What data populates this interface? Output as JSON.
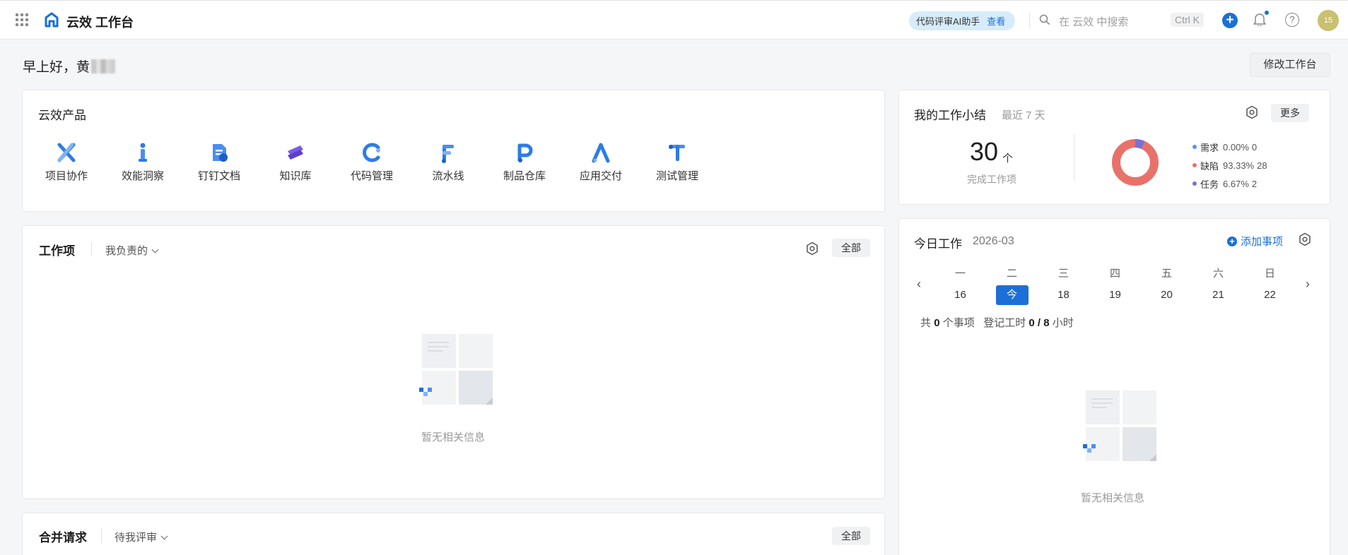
{
  "topbar": {
    "brand": "云效 工作台",
    "ai_pill": "代码评审AI助手",
    "ai_link": "查看",
    "search_placeholder": "在 云效 中搜索",
    "shortcut": "Ctrl K",
    "avatar_text": "15",
    "icons": [
      "apps-icon",
      "logo-icon",
      "search-icon",
      "plus-icon",
      "bell-icon",
      "help-icon"
    ]
  },
  "greeting": {
    "text": "早上好，黄"
  },
  "edit_button": "修改工作台",
  "products": {
    "title": "云效产品",
    "items": [
      {
        "label": "项目协作",
        "icon": "project-icon"
      },
      {
        "label": "效能洞察",
        "icon": "insight-icon"
      },
      {
        "label": "钉钉文档",
        "icon": "doc-icon"
      },
      {
        "label": "知识库",
        "icon": "knowledge-icon"
      },
      {
        "label": "代码管理",
        "icon": "code-icon"
      },
      {
        "label": "流水线",
        "icon": "pipeline-icon"
      },
      {
        "label": "制品仓库",
        "icon": "artifact-icon"
      },
      {
        "label": "应用交付",
        "icon": "delivery-icon"
      },
      {
        "label": "测试管理",
        "icon": "test-icon"
      }
    ]
  },
  "work_items": {
    "title": "工作项",
    "filter": "我负责的",
    "all_button": "全部",
    "empty_text": "暂无相关信息"
  },
  "merge_requests": {
    "title": "合并请求",
    "filter": "待我评审",
    "all_button": "全部"
  },
  "summary": {
    "title": "我的工作小结",
    "subtitle": "最近 7 天",
    "more_button": "更多",
    "completed_count": "30",
    "completed_unit": "个",
    "completed_label": "完成工作项",
    "colors": {
      "requirement": "#5b8ff9",
      "defect": "#e8726a",
      "task": "#7a6fd6"
    },
    "legend": [
      {
        "name": "需求",
        "pct": "0.00%",
        "count": "0"
      },
      {
        "name": "缺陷",
        "pct": "93.33%",
        "count": "28"
      },
      {
        "name": "任务",
        "pct": "6.67%",
        "count": "2"
      }
    ]
  },
  "today": {
    "title": "今日工作",
    "month": "2026-03",
    "add_link": "添加事项",
    "prev": "‹",
    "next": "›",
    "weekdays": [
      "一",
      "二",
      "三",
      "四",
      "五",
      "六",
      "日"
    ],
    "days": [
      "16",
      "今",
      "18",
      "19",
      "20",
      "21",
      "22"
    ],
    "stats_prefix": "共",
    "stats_count": "0",
    "stats_mid": "个事项",
    "stats_hours_label": "登记工时",
    "stats_hours": "0 / 8",
    "stats_unit": "小时",
    "empty_text": "暂无相关信息"
  }
}
